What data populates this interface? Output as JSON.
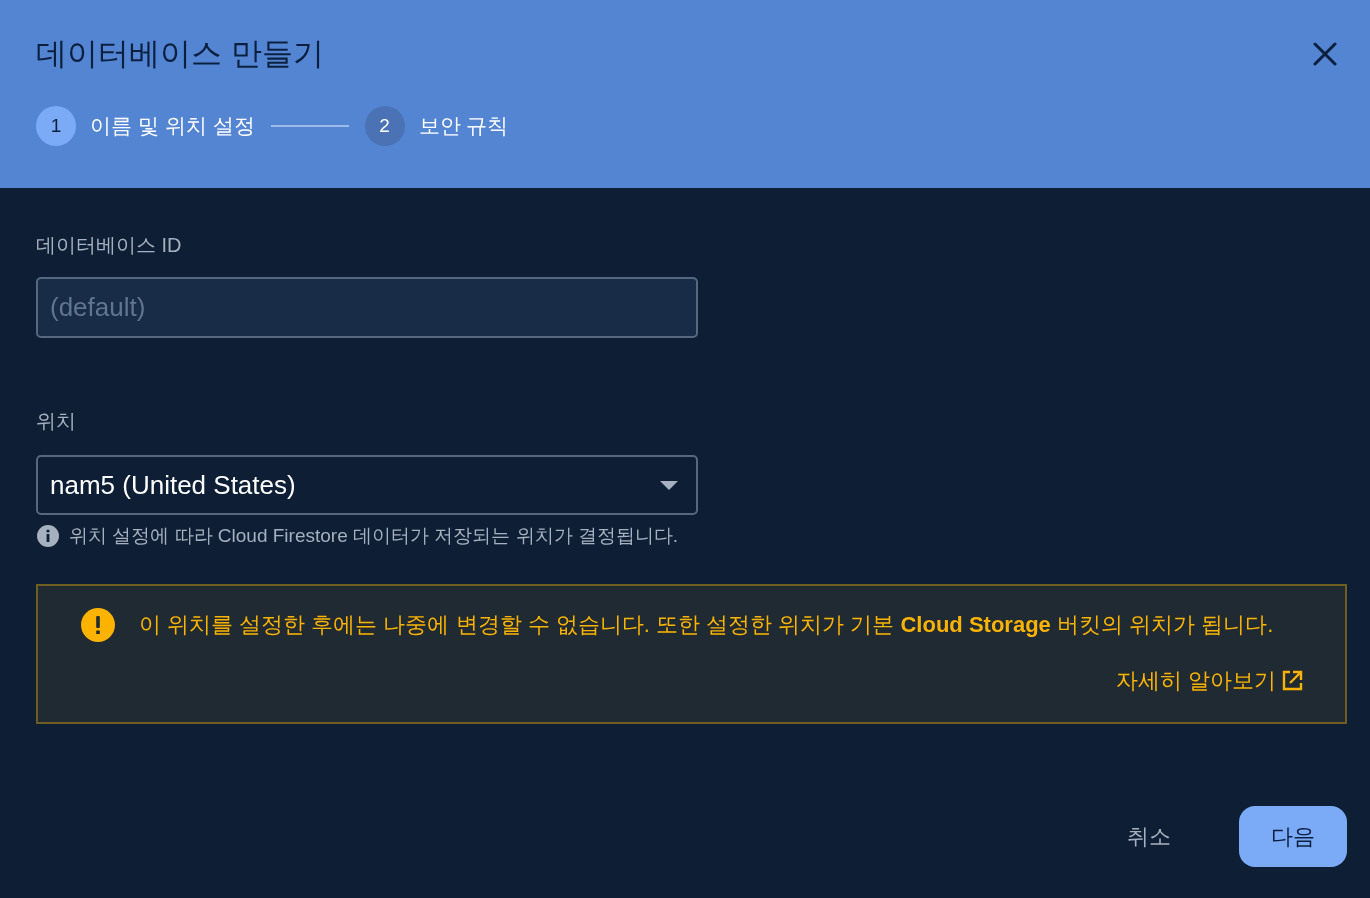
{
  "dialog": {
    "title": "데이터베이스 만들기",
    "steps": [
      {
        "number": "1",
        "label": "이름 및 위치 설정",
        "selected": true
      },
      {
        "number": "2",
        "label": "보안 규칙",
        "selected": false
      }
    ]
  },
  "fields": [
    {
      "kind": "text",
      "label": "데이터베이스 ID",
      "placeholder": "(default)",
      "disabled": true
    },
    {
      "kind": "select",
      "label": "위치",
      "value": "nam5 (United States)",
      "hint": "위치 설정에 따라 Cloud Firestore 데이터가 저장되는 위치가 결정됩니다."
    }
  ],
  "warning": {
    "text": "이 위치를 설정한 후에는 나중에 변경할 수 없습니다. 또한 설정한 위치가 기본 **Cloud Storage** 버킷의 위치가 됩니다.",
    "link": "자세히 알아보기"
  },
  "buttons": [
    {
      "kind": "text",
      "label": "취소"
    },
    {
      "kind": "primary",
      "label": "다음"
    }
  ]
}
